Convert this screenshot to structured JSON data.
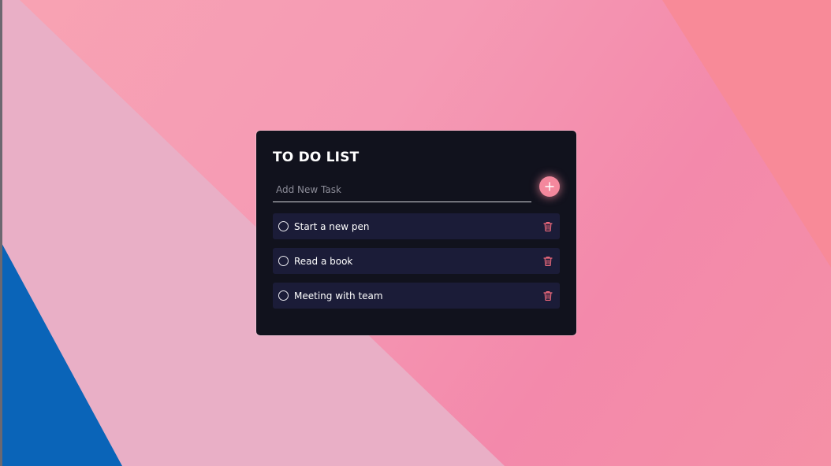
{
  "app": {
    "title": "TO DO LIST"
  },
  "input": {
    "placeholder": "Add New Task",
    "value": ""
  },
  "add_button": {
    "icon": "plus-icon"
  },
  "tasks": [
    {
      "label": "Start a new pen",
      "completed": false
    },
    {
      "label": "Read a book",
      "completed": false
    },
    {
      "label": "Meeting with team",
      "completed": false
    }
  ],
  "colors": {
    "card_background": "#11121d",
    "task_background": "#1b1c38",
    "accent": "#f4889d",
    "delete_icon": "#f06a7c",
    "background_pink": "#f59ab4",
    "background_blue": "#0a64b8"
  }
}
